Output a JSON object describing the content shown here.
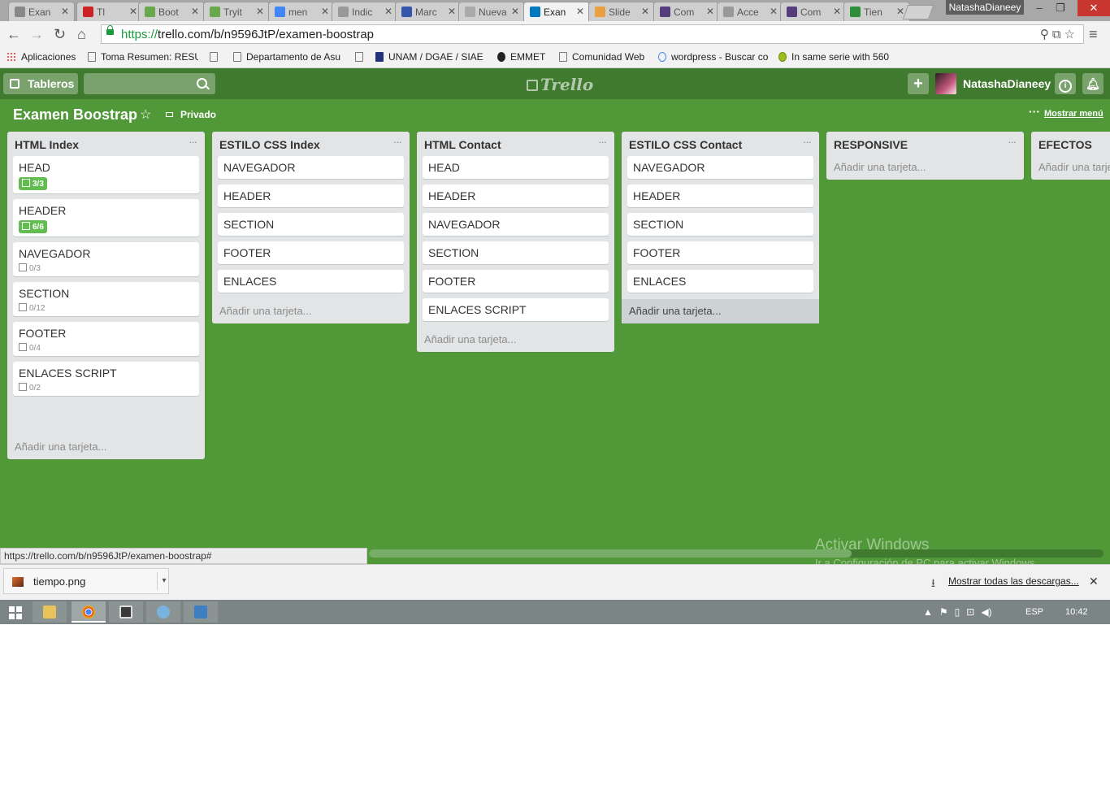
{
  "browser": {
    "tabs": [
      {
        "title": "Exan",
        "favicon_color": "#888888"
      },
      {
        "title": "Tl",
        "favicon_color": "#cc2222"
      },
      {
        "title": "Boot",
        "favicon_color": "#6aa84f"
      },
      {
        "title": "Tryit",
        "favicon_color": "#6aa84f"
      },
      {
        "title": "men",
        "favicon_color": "#4285f4"
      },
      {
        "title": "Indic",
        "favicon_color": "#999999"
      },
      {
        "title": "Marc",
        "favicon_color": "#3355aa"
      },
      {
        "title": "Nueva p",
        "favicon_color": "#aaaaaa"
      },
      {
        "title": "Exan",
        "favicon_color": "#0079bf"
      },
      {
        "title": "Slide",
        "favicon_color": "#e8a040"
      },
      {
        "title": "Com",
        "favicon_color": "#563d7c"
      },
      {
        "title": "Acce",
        "favicon_color": "#999999"
      },
      {
        "title": "Com",
        "favicon_color": "#563d7c"
      },
      {
        "title": "Tien",
        "favicon_color": "#2d8f3a"
      }
    ],
    "profile_name": "NatashaDianeey",
    "url_green": "https://",
    "url_rest": "trello.com/b/n9596JtP/examen-boostrap",
    "bookmarks": [
      "Aplicaciones",
      "Toma Resumen: RESU",
      "",
      "Departamento de Asu",
      "UNAM / DGAE / SIAE",
      "EMMET",
      "Comunidad Web",
      "wordpress - Buscar co",
      "In same serie with 560"
    ]
  },
  "trello": {
    "logo": "Trello",
    "boards_label": "Tableros",
    "user": "NatashaDianeey",
    "board_title": "Examen Boostrap",
    "privacy": "Privado",
    "show_menu": "Mostrar menú",
    "add_card": "Añadir una tarjeta...",
    "lists": [
      {
        "title": "HTML Index",
        "cards": [
          {
            "name": "HEAD",
            "badge": "3/3",
            "done": true
          },
          {
            "name": "HEADER",
            "badge": "6/6",
            "done": true
          },
          {
            "name": "NAVEGADOR",
            "badge": "0/3",
            "done": false
          },
          {
            "name": "SECTION",
            "badge": "0/12",
            "done": false
          },
          {
            "name": "FOOTER",
            "badge": "0/4",
            "done": false
          },
          {
            "name": "ENLACES SCRIPT",
            "badge": "0/2",
            "done": false
          }
        ]
      },
      {
        "title": "ESTILO CSS Index",
        "cards": [
          {
            "name": "NAVEGADOR"
          },
          {
            "name": "HEADER"
          },
          {
            "name": "SECTION"
          },
          {
            "name": "FOOTER"
          },
          {
            "name": "ENLACES"
          }
        ]
      },
      {
        "title": "HTML Contact",
        "cards": [
          {
            "name": "HEAD"
          },
          {
            "name": "HEADER"
          },
          {
            "name": "NAVEGADOR"
          },
          {
            "name": "SECTION"
          },
          {
            "name": "FOOTER"
          },
          {
            "name": "ENLACES SCRIPT"
          }
        ]
      },
      {
        "title": "ESTILO CSS Contact",
        "cards": [
          {
            "name": "NAVEGADOR"
          },
          {
            "name": "HEADER"
          },
          {
            "name": "SECTION"
          },
          {
            "name": "FOOTER"
          },
          {
            "name": "ENLACES"
          }
        ]
      },
      {
        "title": "RESPONSIVE",
        "cards": []
      },
      {
        "title": "EFECTOS",
        "cards": []
      }
    ],
    "status_url": "https://trello.com/b/n9596JtP/examen-boostrap#",
    "watermark_title": "Activar Windows",
    "watermark_sub": "Ir a Configuración de PC para activar Windows."
  },
  "downloads": {
    "file": "tiempo.png",
    "show_all": "Mostrar todas las descargas..."
  },
  "taskbar": {
    "lang": "ESP",
    "time": "10:42"
  }
}
